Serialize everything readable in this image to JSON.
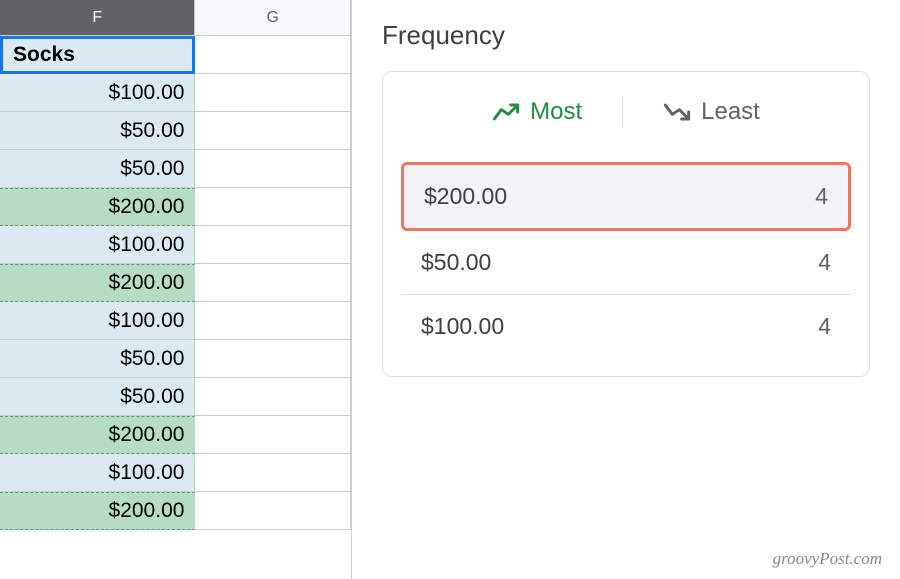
{
  "spreadsheet": {
    "columns": {
      "f": "F",
      "g": "G"
    },
    "header_row": "Socks",
    "rows": [
      {
        "value": "$100.00",
        "style": "blue"
      },
      {
        "value": "$50.00",
        "style": "blue"
      },
      {
        "value": "$50.00",
        "style": "blue"
      },
      {
        "value": "$200.00",
        "style": "green"
      },
      {
        "value": "$100.00",
        "style": "blue"
      },
      {
        "value": "$200.00",
        "style": "green"
      },
      {
        "value": "$100.00",
        "style": "blue"
      },
      {
        "value": "$50.00",
        "style": "blue"
      },
      {
        "value": "$50.00",
        "style": "blue"
      },
      {
        "value": "$200.00",
        "style": "green"
      },
      {
        "value": "$100.00",
        "style": "blue"
      },
      {
        "value": "$200.00",
        "style": "green"
      }
    ]
  },
  "frequency": {
    "title": "Frequency",
    "tabs": {
      "most": "Most",
      "least": "Least"
    },
    "items": [
      {
        "label": "$200.00",
        "count": "4",
        "highlighted": true
      },
      {
        "label": "$50.00",
        "count": "4",
        "highlighted": false
      },
      {
        "label": "$100.00",
        "count": "4",
        "highlighted": false
      }
    ]
  },
  "watermark": "groovyPost.com"
}
